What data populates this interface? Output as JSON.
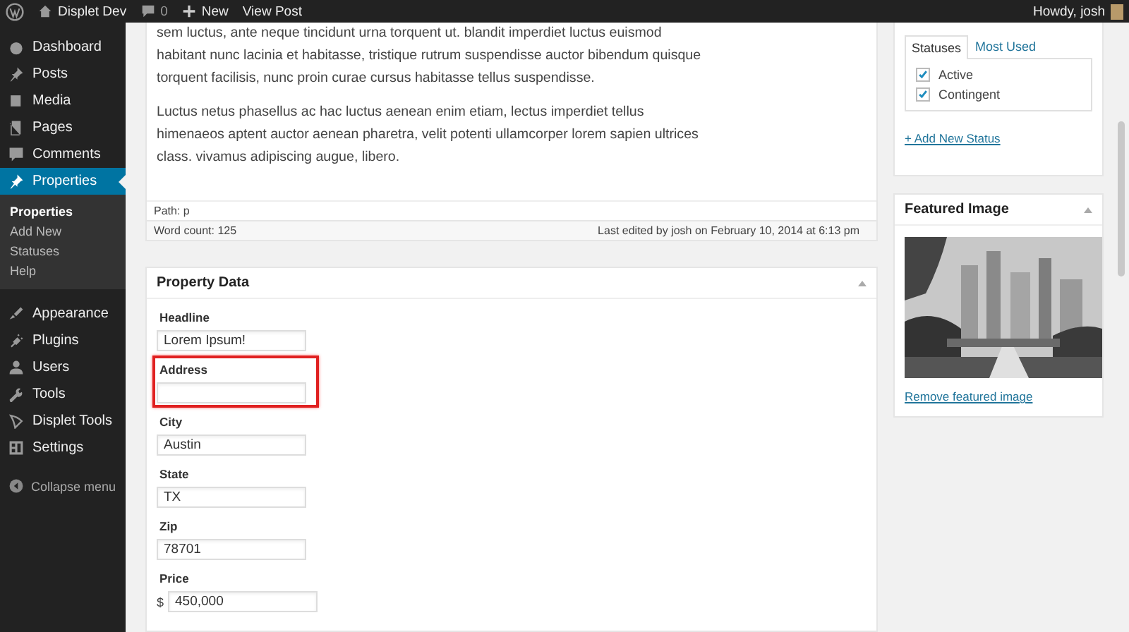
{
  "admin_bar": {
    "site": "Displet Dev",
    "comments": "0",
    "new": "New",
    "view": "View Post",
    "greeting": "Howdy, josh"
  },
  "sidebar": {
    "items": [
      {
        "label": "Dashboard",
        "selected": false
      },
      {
        "label": "Posts",
        "selected": false
      },
      {
        "label": "Media",
        "selected": false
      },
      {
        "label": "Pages",
        "selected": false
      },
      {
        "label": "Comments",
        "selected": false
      },
      {
        "label": "Properties",
        "selected": true,
        "children": [
          {
            "label": "Properties",
            "selected": true
          },
          {
            "label": "Add New",
            "selected": false
          },
          {
            "label": "Statuses",
            "selected": false
          },
          {
            "label": "Help",
            "selected": false
          }
        ]
      },
      {
        "label": "Appearance",
        "selected": false
      },
      {
        "label": "Plugins",
        "selected": false
      },
      {
        "label": "Users",
        "selected": false
      },
      {
        "label": "Tools",
        "selected": false
      },
      {
        "label": "Displet Tools",
        "selected": false
      },
      {
        "label": "Settings",
        "selected": false
      }
    ],
    "collapse": "Collapse menu"
  },
  "editor": {
    "paragraphs": [
      "sem luctus, ante neque tincidunt urna torquent ut. blandit imperdiet luctus euismod habitant nunc lacinia et habitasse, tristique rutrum suspendisse auctor bibendum quisque torquent facilisis, nunc proin curae cursus habitasse tellus suspendisse.",
      "Luctus netus phasellus ac hac luctus aenean enim etiam, lectus imperdiet tellus himenaeos aptent auctor aenean pharetra, velit potenti ullamcorper lorem sapien ultrices class. vivamus adipiscing augue, libero."
    ],
    "path": "Path: p",
    "word_count": "Word count: 125",
    "last_edited": "Last edited by josh on February 10, 2014 at 6:13 pm"
  },
  "property_data": {
    "title": "Property Data",
    "fields": [
      {
        "label": "Headline",
        "value": "Lorem Ipsum!",
        "highlighted": false
      },
      {
        "label": "Address",
        "highlighted": true
      },
      {
        "label": "City",
        "value": "Austin",
        "highlighted": false
      },
      {
        "label": "State",
        "value": "TX",
        "highlighted": false
      },
      {
        "label": "Zip",
        "value": "78701",
        "highlighted": false
      },
      {
        "label": "Price",
        "prefix": "$",
        "value": "450,000",
        "highlighted": false
      }
    ]
  },
  "statuses": {
    "tabs": [
      {
        "label": "Statuses",
        "selected": true
      },
      {
        "label": "Most Used",
        "selected": false
      }
    ],
    "options": [
      {
        "label": "Active",
        "checked": true
      },
      {
        "label": "Contingent",
        "checked": true
      }
    ],
    "add_link": "+ Add New Status"
  },
  "featured_image": {
    "title": "Featured Image",
    "remove_link": "Remove featured image"
  }
}
